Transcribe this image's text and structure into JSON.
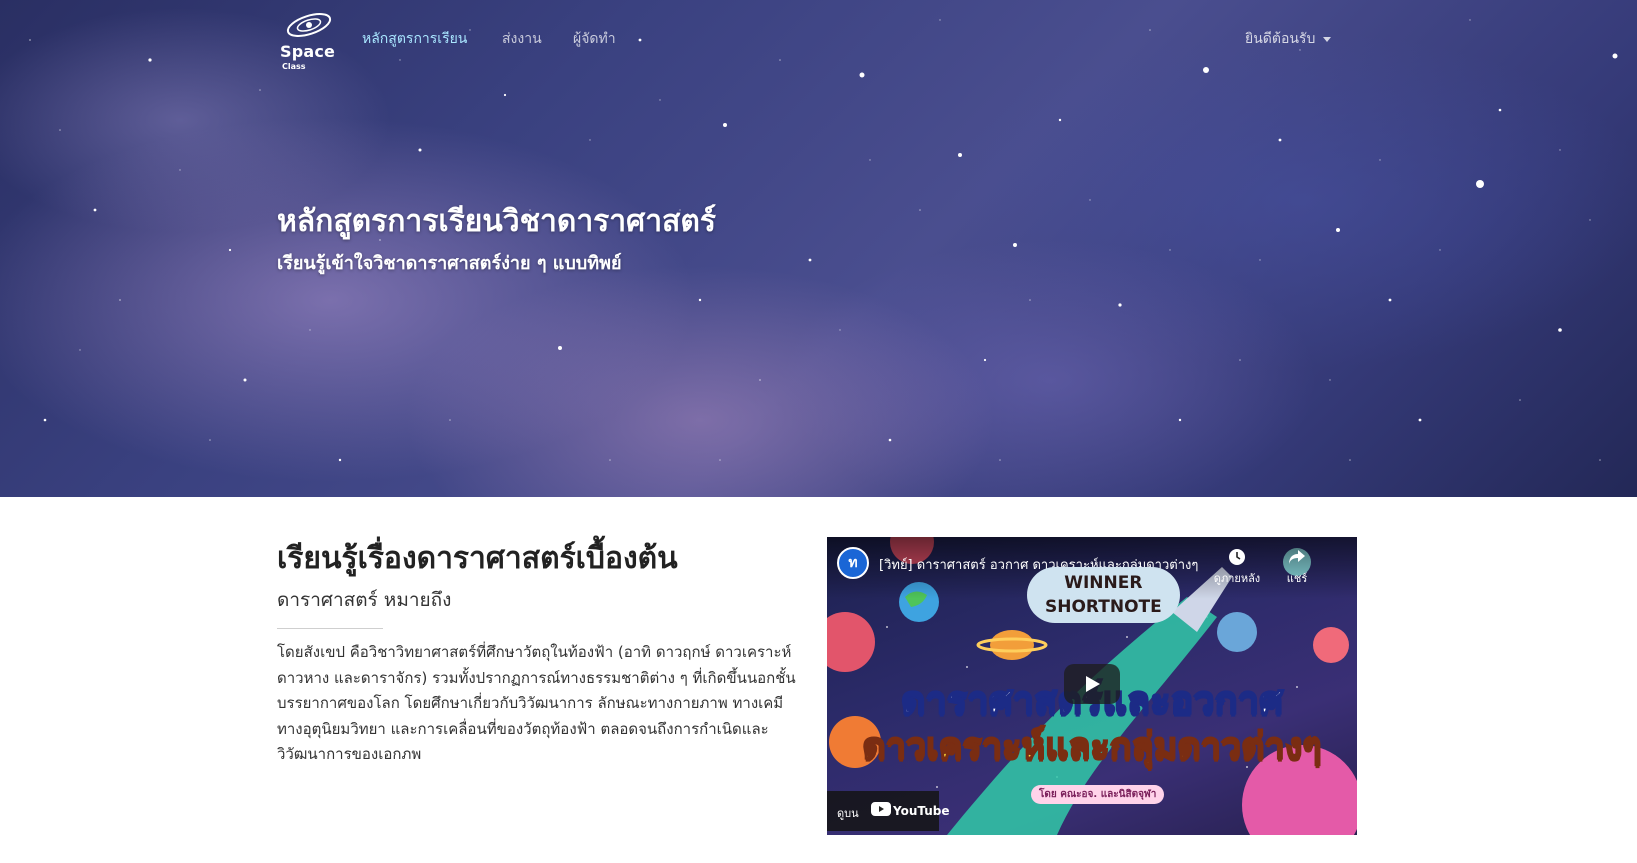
{
  "brand": {
    "logo_title": "Space",
    "logo_subtitle": "Class"
  },
  "nav": {
    "items": [
      {
        "label": "หลักสูตรการเรียน",
        "active": true
      },
      {
        "label": "ส่งงาน",
        "active": false
      },
      {
        "label": "ผู้จัดทำ",
        "active": false
      }
    ],
    "user_menu": "ยินดีต้อนรับ"
  },
  "hero": {
    "title": "หลักสูตรการเรียนวิชาดาราศาสตร์",
    "subtitle": "เรียนรู้เข้าใจวิชาดาราศาสตร์ง่าย ๆ แบบทิพย์"
  },
  "content": {
    "title": "เรียนรู้เรื่องดาราศาสตร์เบื้องต้น",
    "subtitle": "ดาราศาสตร์ หมายถึง",
    "body": "โดยสังเขป คือวิชาวิทยาศาสตร์ที่ศึกษาวัตถุในท้องฟ้า (อาทิ ดาวฤกษ์ ดาวเคราะห์ ดาวหาง และดาราจักร) รวมทั้งปรากฏการณ์ทางธรรมชาติต่าง ๆ ที่เกิดขึ้นนอกชั้นบรรยากาศของโลก โดยศึกษาเกี่ยวกับวิวัฒนาการ ลักษณะทางกายภาพ ทางเคมี ทางอุตุนิยมวิทยา และการเคลื่อนที่ของวัตถุท้องฟ้า ตลอดจนถึงการกำเนิดและวิวัฒนาการของเอกภพ"
  },
  "video": {
    "title": "[วิทย์] ดาราศาสตร์ อวกาศ ดาวเคราะห์และกลุ่มดาวต่างๆ",
    "watch_later": "ดูภายหลัง",
    "share": "แชร์",
    "watch_on": "ดูบน",
    "youtube": "YouTube",
    "overlay": {
      "badge_line1": "WINNER",
      "badge_line2": "SHORTNOTE",
      "headline1": "ดาราศาสตร์และอวกาศ",
      "headline2": "ดาวเคราะห์และกลุ่มดาวต่างๆ",
      "byline": "โดย คณะอจ. และนิสิตจุฬา"
    }
  }
}
